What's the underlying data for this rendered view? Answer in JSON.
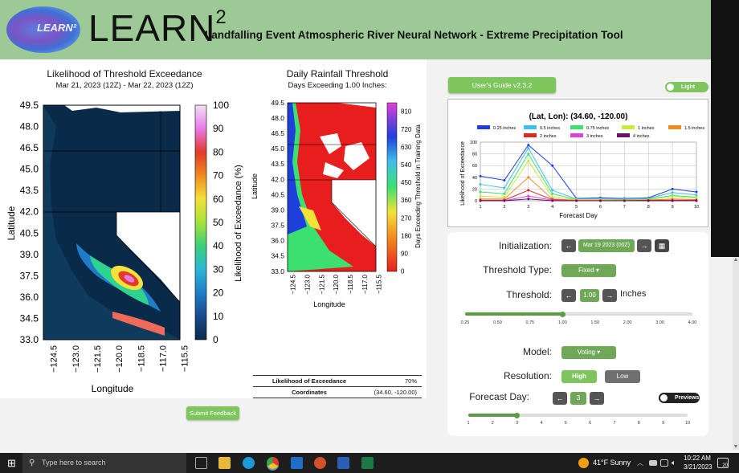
{
  "header": {
    "app_name": "LEARN",
    "app_name_sup": "2",
    "logo_text": "LEARN²",
    "subtitle": "Landfalling Event Atmospheric River Neural Network - Extreme Precipitation Tool"
  },
  "left_map": {
    "title": "Likelihood of Threshold Exceedance",
    "subtitle": "Mar 21, 2023 (12Z) - Mar 22, 2023 (12Z)",
    "ylabel": "Latitude",
    "xlabel": "Longitude",
    "lat_ticks": [
      "49.5",
      "48.0",
      "46.5",
      "45.0",
      "43.5",
      "42.0",
      "40.5",
      "39.0",
      "37.5",
      "36.0",
      "34.5",
      "33.0"
    ],
    "lon_ticks": [
      "−124.5",
      "−123.0",
      "−121.5",
      "−120.0",
      "−118.5",
      "−117.0",
      "−115.5"
    ],
    "colorbar_label": "Likelihood of Exceedance (%)",
    "colorbar_ticks": [
      "100",
      "90",
      "80",
      "70",
      "60",
      "50",
      "40",
      "30",
      "20",
      "10",
      "0"
    ]
  },
  "mid_map": {
    "title": "Daily Rainfall Threshold",
    "subtitle": "Days Exceeding 1.00 Inches:",
    "ylabel": "Latitude",
    "xlabel": "Longitude",
    "lat_ticks": [
      "49.5",
      "48.0",
      "46.5",
      "45.0",
      "43.5",
      "42.0",
      "40.5",
      "39.0",
      "37.5",
      "36.0",
      "34.5",
      "33.0"
    ],
    "lon_ticks": [
      "−124.5",
      "−123.0",
      "−121.5",
      "−120.0",
      "−118.5",
      "−117.0",
      "−115.5"
    ],
    "colorbar_label": "Days Exceeding Threshold in Training Data",
    "colorbar_ticks": [
      "810",
      "720",
      "630",
      "540",
      "450",
      "360",
      "270",
      "180",
      "90",
      "0"
    ]
  },
  "info_table": [
    {
      "key": "Likelihood of Exceedance",
      "value": "70%"
    },
    {
      "key": "Coordinates",
      "value": "(34.60, -120.00)"
    }
  ],
  "submit_feedback": "Submit Feedback",
  "users_guide": "User's Guide v2.3.2",
  "theme_toggle": "Light",
  "chart_data": {
    "type": "line",
    "title": "(Lat, Lon): (34.60, -120.00)",
    "xlabel": "Forecast Day",
    "ylabel": "Likelihood of Exceedance",
    "ylim": [
      0,
      100
    ],
    "x": [
      1,
      2,
      3,
      4,
      5,
      6,
      7,
      8,
      9,
      10
    ],
    "yticks": [
      0,
      20,
      40,
      60,
      80,
      100
    ],
    "legend_position": "top",
    "series": [
      {
        "name": "0.25 inches",
        "color": "#1f3fdc",
        "values": [
          42,
          35,
          95,
          60,
          4,
          5,
          4,
          5,
          20,
          15
        ]
      },
      {
        "name": "0.5 inches",
        "color": "#3fc0e8",
        "values": [
          28,
          22,
          90,
          18,
          3,
          3,
          3,
          4,
          14,
          10
        ]
      },
      {
        "name": "0.75 inches",
        "color": "#3ce070",
        "values": [
          15,
          12,
          80,
          12,
          2,
          2,
          2,
          3,
          9,
          6
        ]
      },
      {
        "name": "1 inches",
        "color": "#c6ec3a",
        "values": [
          8,
          6,
          68,
          6,
          2,
          2,
          1,
          2,
          7,
          5
        ]
      },
      {
        "name": "1.5 inches",
        "color": "#f08a1e",
        "values": [
          3,
          3,
          40,
          3,
          1,
          1,
          1,
          1,
          3,
          2
        ]
      },
      {
        "name": "2 inches",
        "color": "#e0241e",
        "values": [
          1,
          1,
          18,
          2,
          0,
          0,
          0,
          1,
          1,
          1
        ]
      },
      {
        "name": "3 inches",
        "color": "#e040d8",
        "values": [
          0,
          0,
          8,
          1,
          0,
          0,
          0,
          0,
          0,
          0
        ]
      },
      {
        "name": "4 inches",
        "color": "#6a1070",
        "values": [
          0,
          0,
          3,
          0,
          0,
          0,
          0,
          0,
          0,
          0
        ]
      }
    ]
  },
  "controls": {
    "initialization_label": "Initialization:",
    "initialization_value": "Mar 19 2023 (00Z)",
    "threshold_type_label": "Threshold Type:",
    "threshold_type_value": "Fixed",
    "threshold_label": "Threshold:",
    "threshold_value": "1.00",
    "threshold_unit": "Inches",
    "threshold_ticks": [
      "0.25",
      "0.50",
      "0.75",
      "1.00",
      "1.50",
      "2.00",
      "3.00",
      "4.00"
    ],
    "threshold_slider_fraction": 0.428,
    "model_label": "Model:",
    "model_value": "Voting",
    "resolution_label": "Resolution:",
    "resolution_high": "High",
    "resolution_low": "Low",
    "forecast_day_label": "Forecast Day:",
    "forecast_day_value": "3",
    "forecast_day_ticks": [
      "1",
      "2",
      "3",
      "4",
      "5",
      "6",
      "7",
      "8",
      "9",
      "10"
    ],
    "forecast_slider_fraction": 0.2222,
    "previews_toggle": "Previews",
    "left_arrow": "←",
    "right_arrow": "→",
    "dropdown_caret": "▾",
    "calendar_icon": "▦"
  },
  "taskbar": {
    "start_icon": "⊞",
    "search_placeholder": "Type here to search",
    "weather": "41°F  Sunny",
    "time": "10:22 AM",
    "date": "3/21/2023",
    "notification_count": "20"
  }
}
